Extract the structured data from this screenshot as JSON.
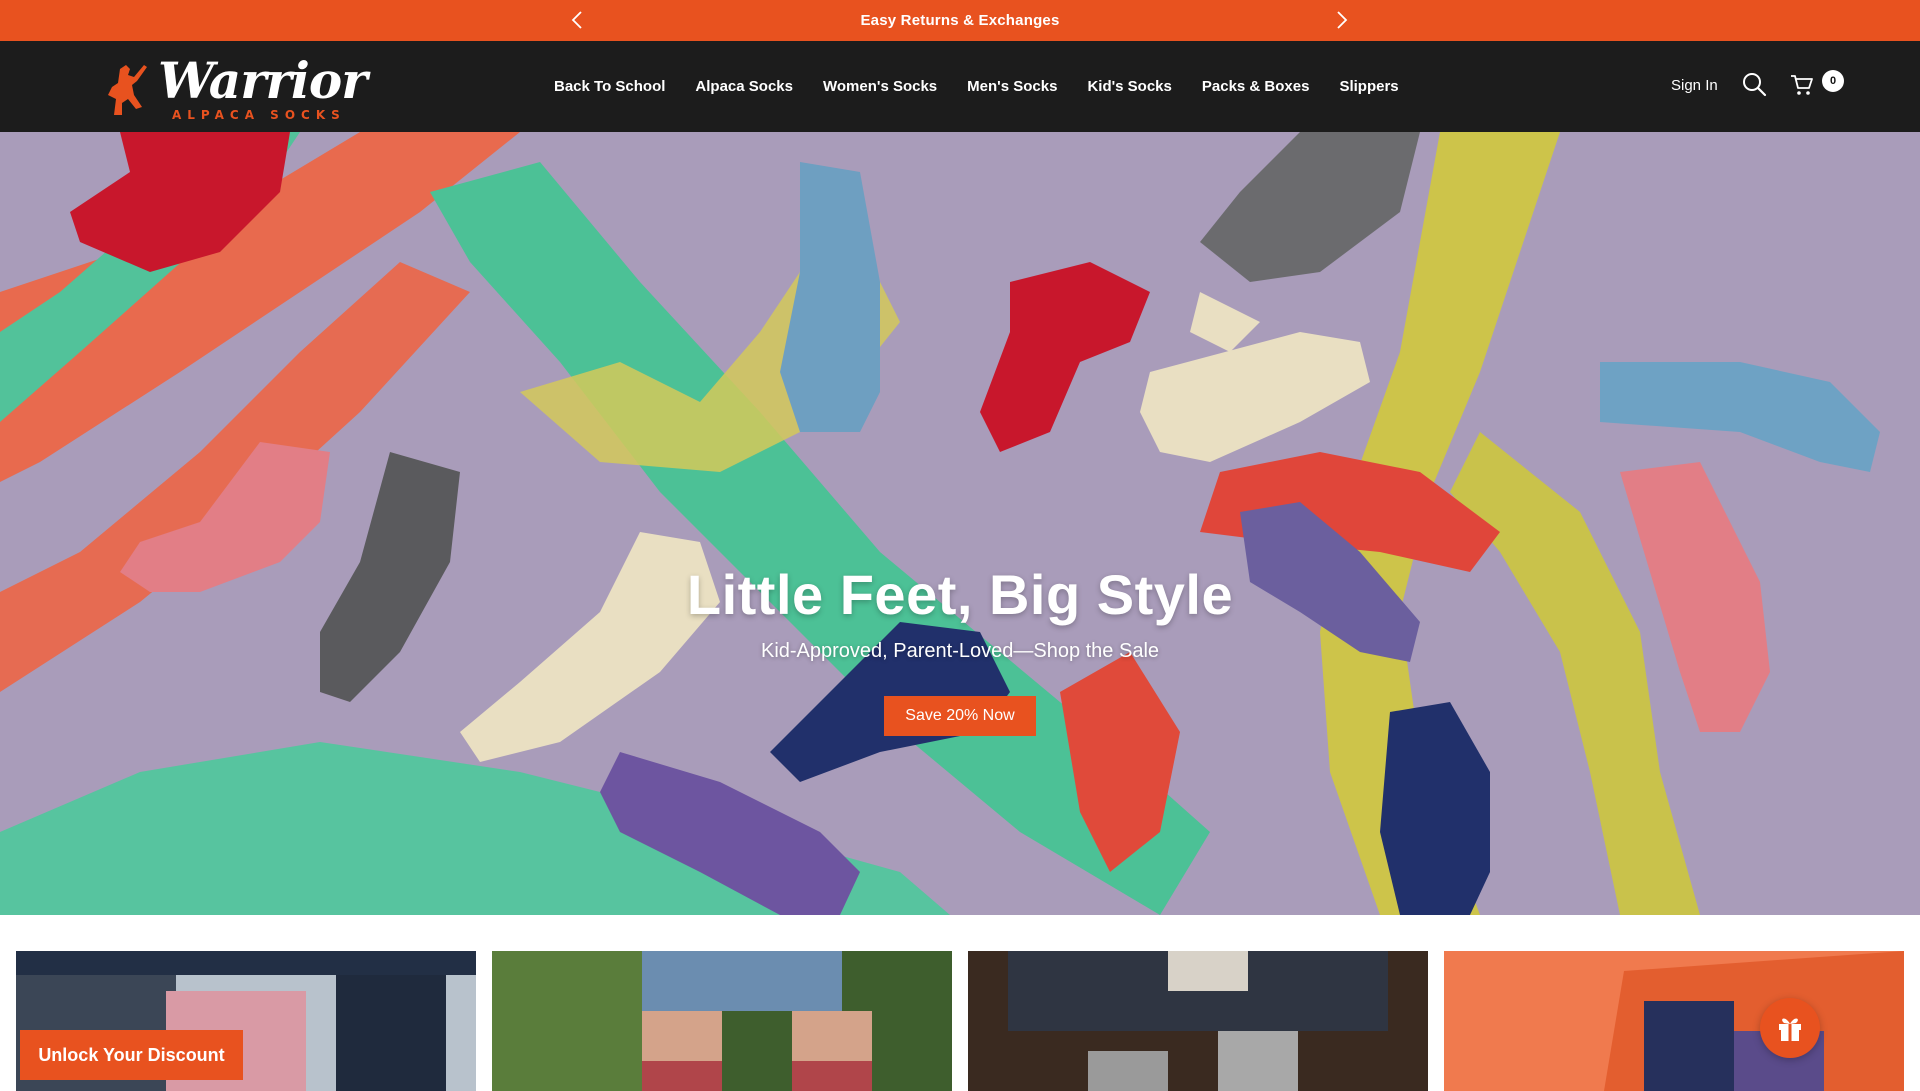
{
  "announcement": {
    "message": "Easy Returns & Exchanges",
    "prev_icon": "chevron-left-icon",
    "next_icon": "chevron-right-icon"
  },
  "brand": {
    "name": "Warrior",
    "tagline": "ALPACA SOCKS",
    "accent_color": "#e8521f",
    "header_bg": "#1c1c1c"
  },
  "nav": {
    "items": [
      {
        "label": "Back To School"
      },
      {
        "label": "Alpaca Socks"
      },
      {
        "label": "Women's Socks"
      },
      {
        "label": "Men's Socks"
      },
      {
        "label": "Kid's Socks"
      },
      {
        "label": "Packs & Boxes"
      },
      {
        "label": "Slippers"
      }
    ]
  },
  "header_actions": {
    "sign_in": "Sign In",
    "search_icon": "search-icon",
    "cart_icon": "cart-icon",
    "cart_count": "0"
  },
  "hero": {
    "title": "Little Feet, Big Style",
    "subtitle": "Kid-Approved, Parent-Loved—Shop the Sale",
    "cta": "Save 20% Now"
  },
  "tiles": [
    {
      "name": "tile-1"
    },
    {
      "name": "tile-2"
    },
    {
      "name": "tile-3"
    },
    {
      "name": "tile-4"
    }
  ],
  "floating": {
    "discount_label": "Unlock Your Discount",
    "gift_icon": "gift-icon"
  }
}
